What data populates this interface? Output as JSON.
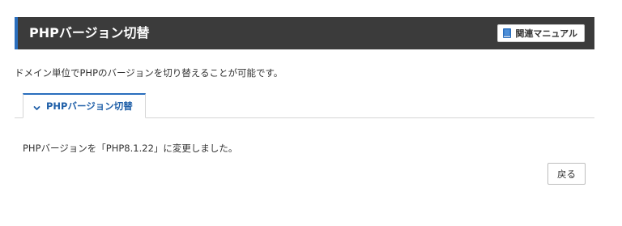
{
  "header": {
    "title": "PHPバージョン切替",
    "manual_button_label": "関連マニュアル",
    "manual_icon": "book-icon"
  },
  "description": "ドメイン単位でPHPのバージョンを切り替えることが可能です。",
  "tabs": [
    {
      "label": "PHPバージョン切替",
      "icon": "chevron-down-icon",
      "active": true
    }
  ],
  "result": {
    "message": "PHPバージョンを「PHP8.1.22」に変更しました。"
  },
  "actions": {
    "back_label": "戻る"
  },
  "colors": {
    "header_bg": "#3b3b3b",
    "accent": "#2a6ebd",
    "tab_text": "#1f5fa8"
  }
}
